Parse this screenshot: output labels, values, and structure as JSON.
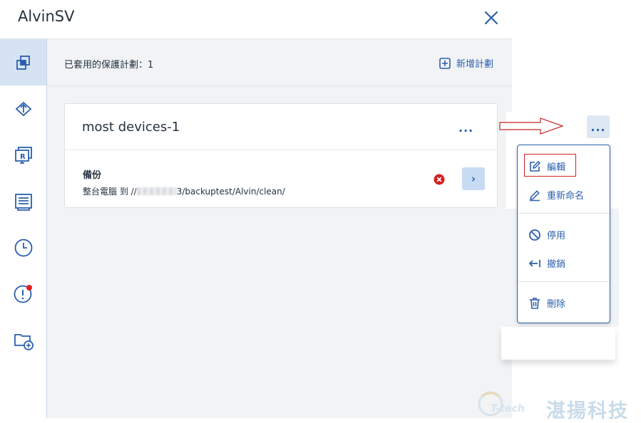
{
  "header": {
    "title": "AlvinSV",
    "close_icon": "close-icon"
  },
  "sidebar": {
    "items": [
      {
        "name": "plans",
        "icon": "protection-plans-icon",
        "active": true
      },
      {
        "name": "recovery",
        "icon": "recovery-icon",
        "active": false
      },
      {
        "name": "remote",
        "icon": "remote-desktop-icon",
        "active": false
      },
      {
        "name": "details",
        "icon": "details-icon",
        "active": false
      },
      {
        "name": "activities",
        "icon": "clock-icon",
        "active": false
      },
      {
        "name": "alerts",
        "icon": "alert-icon",
        "active": false
      },
      {
        "name": "add-folder",
        "icon": "folder-add-icon",
        "active": false
      }
    ]
  },
  "main": {
    "applied_plans_label": "已套用的保護計劃：1",
    "add_plan_label": "新增計劃",
    "plan": {
      "name": "most devices-1",
      "more_label": "...",
      "module_title": "備份",
      "module_desc_prefix": "整台電腦 到 //",
      "module_desc_suffix": "3/backuptest/Alvin/clean/",
      "status": "error",
      "go_label": "›"
    }
  },
  "zoom": {
    "more_label": "...",
    "menu": [
      {
        "label": "編輯",
        "icon": "edit-icon"
      },
      {
        "label": "重新命名",
        "icon": "rename-icon"
      },
      {
        "label": "停用",
        "icon": "disable-icon"
      },
      {
        "label": "撤銷",
        "icon": "revoke-icon"
      },
      {
        "label": "刪除",
        "icon": "delete-icon"
      }
    ]
  },
  "watermark": {
    "brand": "T-tech",
    "text": "湛揚科技"
  },
  "colors": {
    "accent": "#2b5fad",
    "active_bg": "#d6e3f3",
    "error": "#d42020",
    "panel_bg": "#f1f3f5"
  }
}
